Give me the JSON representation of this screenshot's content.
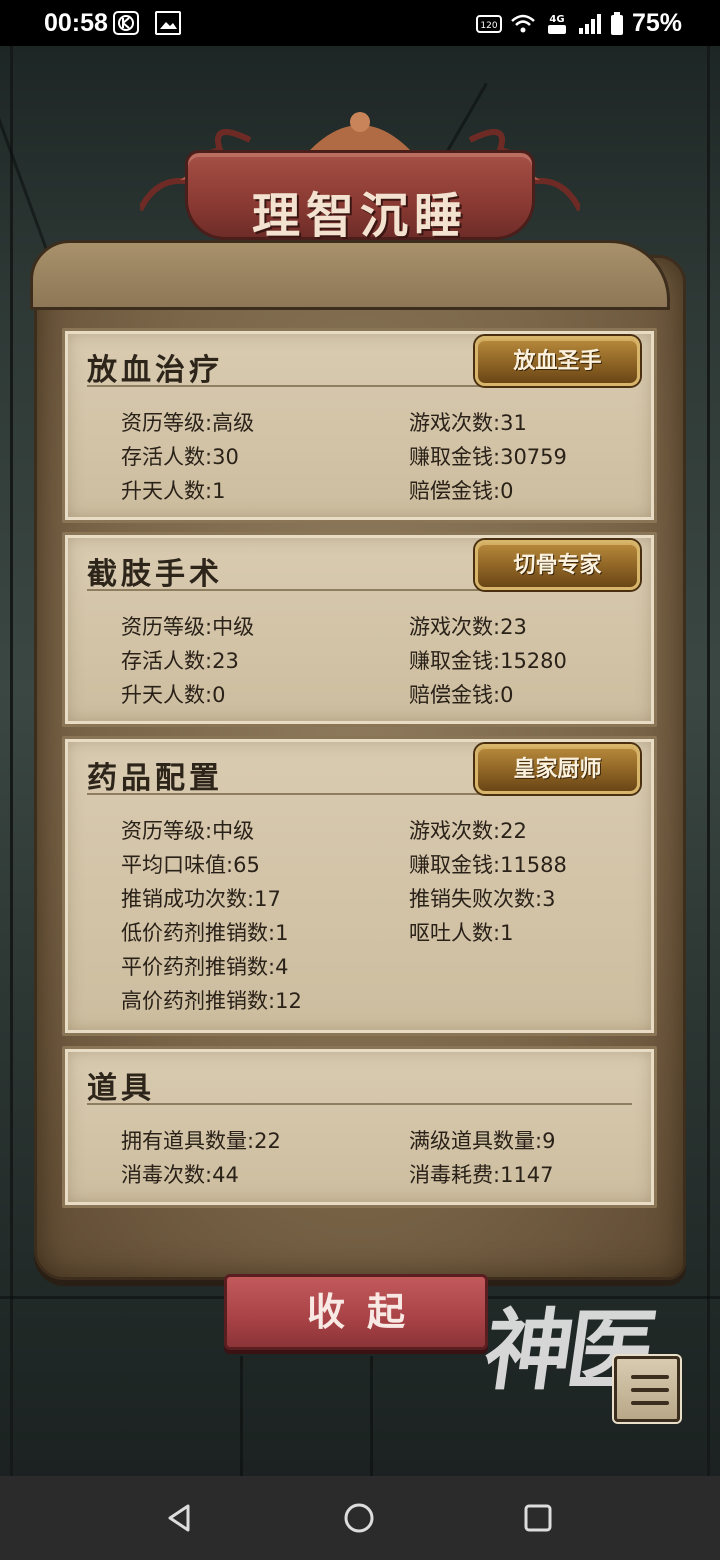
{
  "status_bar": {
    "time": "00:58",
    "battery_percent": "75%",
    "icons": [
      "notification-k-icon",
      "image-icon",
      "hd-voice-icon",
      "wifi-icon",
      "4g-icon",
      "signal-icon",
      "battery-icon"
    ]
  },
  "title": "理智沉睡",
  "sections": [
    {
      "name": "放血治疗",
      "badge": "放血圣手",
      "stats": [
        {
          "label": "资历等级",
          "value": "高级"
        },
        {
          "label": "游戏次数",
          "value": "31"
        },
        {
          "label": "存活人数",
          "value": "30"
        },
        {
          "label": "赚取金钱",
          "value": "30759"
        },
        {
          "label": "升天人数",
          "value": "1"
        },
        {
          "label": "赔偿金钱",
          "value": "0"
        }
      ]
    },
    {
      "name": "截肢手术",
      "badge": "切骨专家",
      "stats": [
        {
          "label": "资历等级",
          "value": "中级"
        },
        {
          "label": "游戏次数",
          "value": "23"
        },
        {
          "label": "存活人数",
          "value": "23"
        },
        {
          "label": "赚取金钱",
          "value": "15280"
        },
        {
          "label": "升天人数",
          "value": "0"
        },
        {
          "label": "赔偿金钱",
          "value": "0"
        }
      ]
    },
    {
      "name": "药品配置",
      "badge": "皇家厨师",
      "stats": [
        {
          "label": "资历等级",
          "value": "中级"
        },
        {
          "label": "游戏次数",
          "value": "22"
        },
        {
          "label": "平均口味值",
          "value": "65"
        },
        {
          "label": "赚取金钱",
          "value": "11588"
        },
        {
          "label": "推销成功次数",
          "value": "17"
        },
        {
          "label": "推销失败次数",
          "value": "3"
        },
        {
          "label": "低价药剂推销数",
          "value": "1"
        },
        {
          "label": "呕吐人数",
          "value": "1"
        },
        {
          "label": "平价药剂推销数",
          "value": "4"
        },
        {
          "label": "高价药剂推销数",
          "value": "12"
        }
      ]
    },
    {
      "name": "道具",
      "stats": [
        {
          "label": "拥有道具数量",
          "value": "22"
        },
        {
          "label": "满级道具数量",
          "value": "9"
        },
        {
          "label": "消毒次数",
          "value": "44"
        },
        {
          "label": "消毒耗费",
          "value": "1147"
        }
      ]
    }
  ],
  "collapse_button": "收起",
  "logo_text": "神医",
  "colors": {
    "parchment": "#cdbd9f",
    "title_ribbon": "#8a3a33",
    "badge_gold": "#b88a3c",
    "button_red": "#a84246"
  }
}
